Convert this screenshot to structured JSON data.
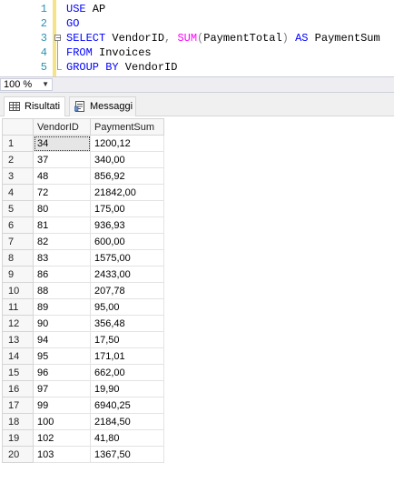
{
  "editor": {
    "lines": [
      {
        "num": "1",
        "tokens": [
          {
            "t": "USE",
            "c": "kw"
          },
          {
            "t": " AP",
            "c": ""
          }
        ]
      },
      {
        "num": "2",
        "tokens": [
          {
            "t": "GO",
            "c": "kw"
          }
        ]
      },
      {
        "num": "3",
        "tokens": [
          {
            "t": "SELECT",
            "c": "kw"
          },
          {
            "t": " VendorID",
            "c": ""
          },
          {
            "t": ",",
            "c": "gy"
          },
          {
            "t": " ",
            "c": ""
          },
          {
            "t": "SUM",
            "c": "fn"
          },
          {
            "t": "(",
            "c": "gy"
          },
          {
            "t": "PaymentTotal",
            "c": ""
          },
          {
            "t": ")",
            "c": "gy"
          },
          {
            "t": " ",
            "c": ""
          },
          {
            "t": "AS",
            "c": "kw"
          },
          {
            "t": " PaymentSum",
            "c": ""
          }
        ]
      },
      {
        "num": "4",
        "tokens": [
          {
            "t": "FROM",
            "c": "kw"
          },
          {
            "t": " Invoices",
            "c": ""
          }
        ]
      },
      {
        "num": "5",
        "tokens": [
          {
            "t": "GROUP BY",
            "c": "kw"
          },
          {
            "t": " VendorID",
            "c": ""
          }
        ]
      }
    ],
    "collapse_symbol": "−"
  },
  "statusbar": {
    "zoom": "100 %",
    "zoom_arrow": "▼"
  },
  "tabs": [
    {
      "label": "Risultati",
      "icon": "grid-icon",
      "active": true
    },
    {
      "label": "Messaggi",
      "icon": "message-icon",
      "active": false
    }
  ],
  "results": {
    "columns": [
      "VendorID",
      "PaymentSum"
    ],
    "rows": [
      [
        "1",
        "34",
        "1200,12"
      ],
      [
        "2",
        "37",
        "340,00"
      ],
      [
        "3",
        "48",
        "856,92"
      ],
      [
        "4",
        "72",
        "21842,00"
      ],
      [
        "5",
        "80",
        "175,00"
      ],
      [
        "6",
        "81",
        "936,93"
      ],
      [
        "7",
        "82",
        "600,00"
      ],
      [
        "8",
        "83",
        "1575,00"
      ],
      [
        "9",
        "86",
        "2433,00"
      ],
      [
        "10",
        "88",
        "207,78"
      ],
      [
        "11",
        "89",
        "95,00"
      ],
      [
        "12",
        "90",
        "356,48"
      ],
      [
        "13",
        "94",
        "17,50"
      ],
      [
        "14",
        "95",
        "171,01"
      ],
      [
        "15",
        "96",
        "662,00"
      ],
      [
        "16",
        "97",
        "19,90"
      ],
      [
        "17",
        "99",
        "6940,25"
      ],
      [
        "18",
        "100",
        "2184,50"
      ],
      [
        "19",
        "102",
        "41,80"
      ],
      [
        "20",
        "103",
        "1367,50"
      ]
    ]
  },
  "colors": {
    "keyword": "#0000ff",
    "function": "#ff00ff",
    "operator": "#808080",
    "line_number": "#2b91af",
    "margin_highlight": "#f5e38a"
  }
}
